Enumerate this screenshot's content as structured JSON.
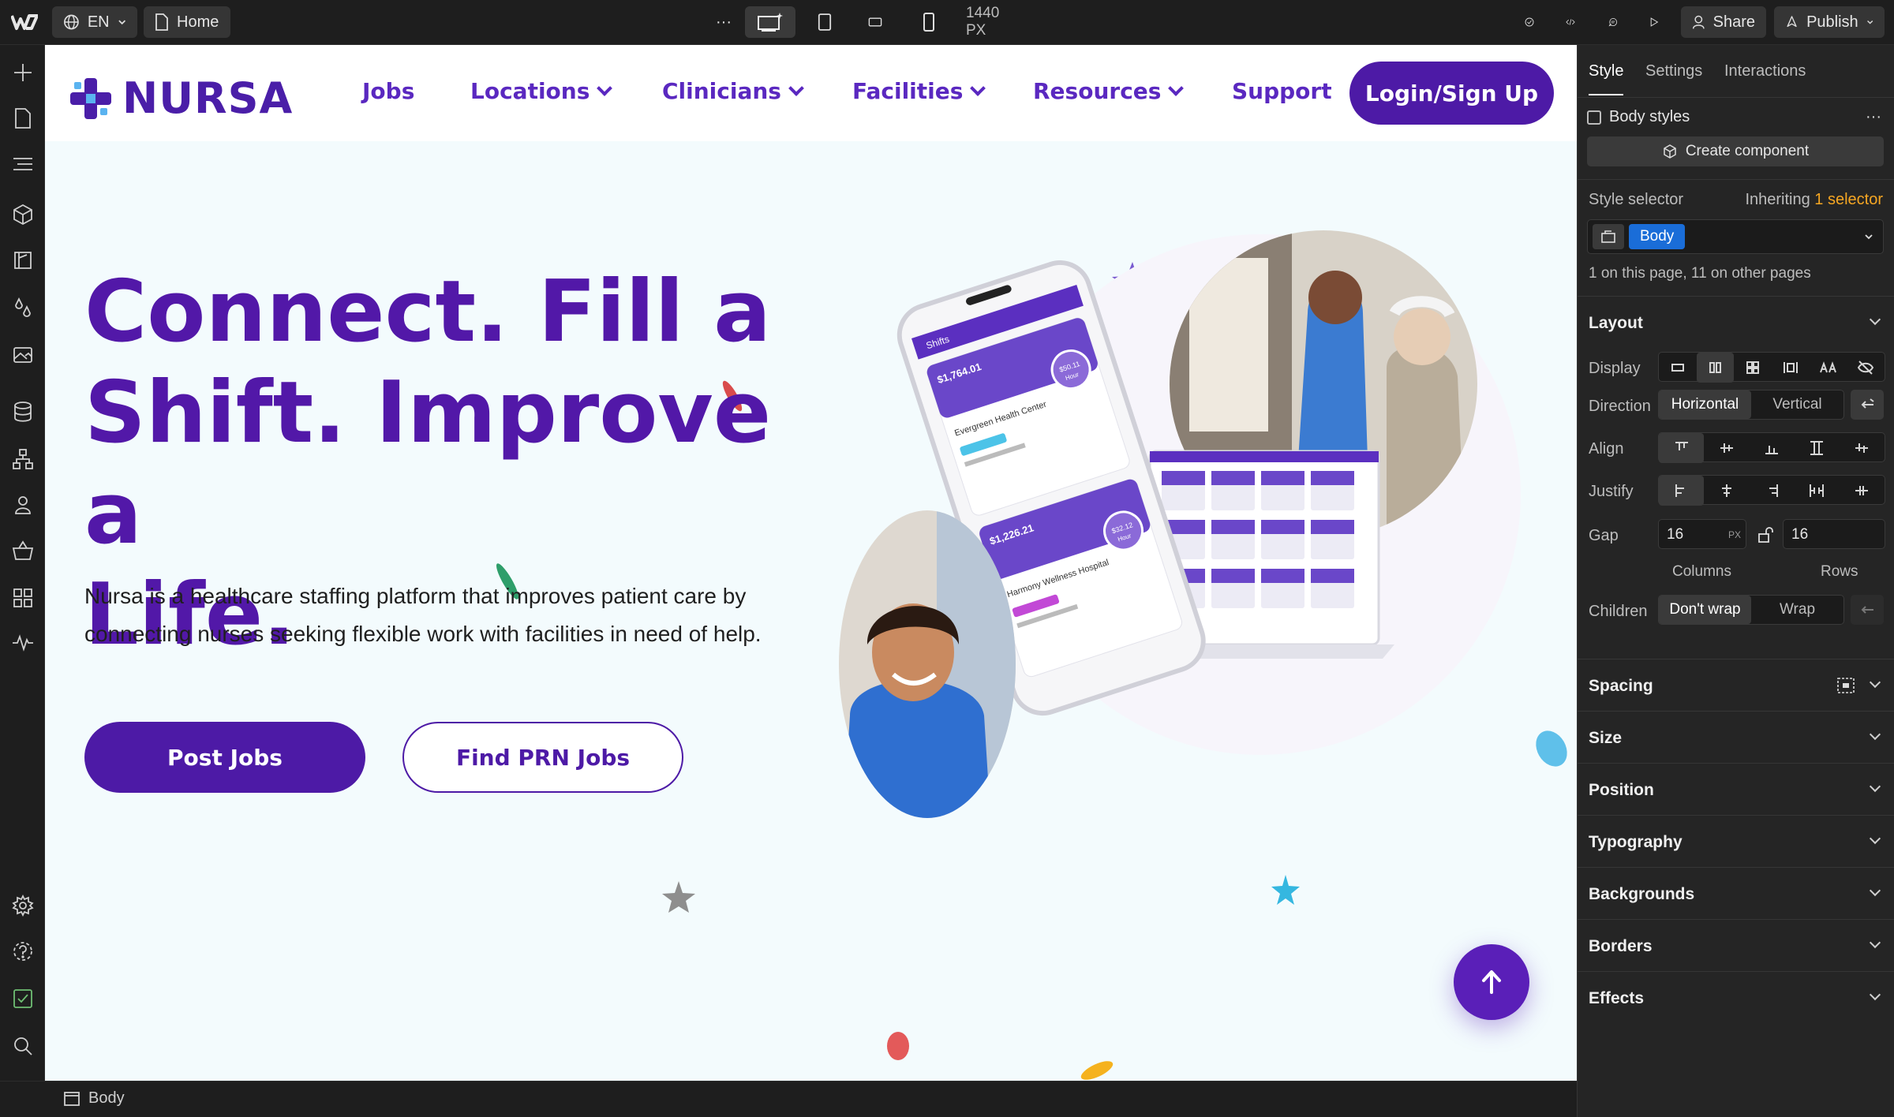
{
  "topbar": {
    "locale": "EN",
    "page": "Home",
    "more": "···",
    "width_label": "1440 PX",
    "share": "Share",
    "publish": "Publish"
  },
  "site": {
    "logo": "NURSA",
    "nav": {
      "jobs": "Jobs",
      "locations": "Locations",
      "clinicians": "Clinicians",
      "facilities": "Facilities",
      "resources": "Resources",
      "support": "Support",
      "login": "Login/Sign Up"
    },
    "hero": {
      "line1": "Connect. Fill a",
      "line2": "Shift. Improve a",
      "line3": "Life.",
      "description": "Nursa is a healthcare staffing platform that improves patient care by connecting nurses seeking flexible work with facilities in need of help.",
      "post_jobs": "Post Jobs",
      "find_jobs": "Find PRN Jobs"
    },
    "mockup": {
      "header": "Shifts",
      "price1": "$1,764.01",
      "facility1": "Evergreen Health Center",
      "rate1": "$50.11",
      "rate1_unit": "Hour",
      "price2": "$1,226.21",
      "facility2": "Harmony Wellness Hospital",
      "rate2": "$32.12",
      "rate2_unit": "Hour"
    }
  },
  "breadcrumb": {
    "body": "Body"
  },
  "panel": {
    "tabs": [
      "Style",
      "Settings",
      "Interactions"
    ],
    "body_styles": "Body styles",
    "create_component": "Create component",
    "style_selector": "Style selector",
    "inheriting": "Inheriting",
    "inheriting_count": "1 selector",
    "selector_tag": "Body",
    "usage": "1 on this page, 11 on other pages",
    "layout": {
      "title": "Layout",
      "display": "Display",
      "direction": "Direction",
      "horizontal": "Horizontal",
      "vertical": "Vertical",
      "align": "Align",
      "justify": "Justify",
      "gap": "Gap",
      "gap_columns": "16",
      "gap_unit": "PX",
      "gap_rows": "16",
      "columns": "Columns",
      "rows": "Rows",
      "children": "Children",
      "dont_wrap": "Don't wrap",
      "wrap": "Wrap"
    },
    "sections": {
      "spacing": "Spacing",
      "size": "Size",
      "position": "Position",
      "typography": "Typography",
      "backgrounds": "Backgrounds",
      "borders": "Borders",
      "effects": "Effects"
    }
  },
  "colors": {
    "brand_purple": "#4d1aa6",
    "accent_orange": "#f5a623",
    "selector_blue": "#1a6dd8"
  }
}
